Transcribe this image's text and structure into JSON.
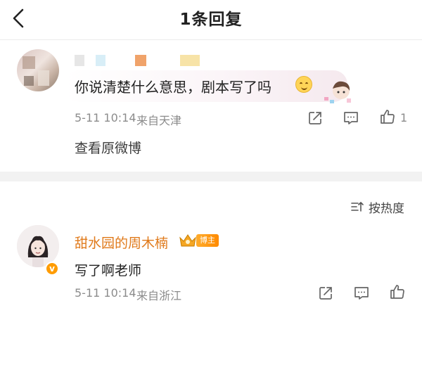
{
  "header": {
    "title": "1条回复"
  },
  "original": {
    "text": "你说清楚什么意思，剧本写了吗",
    "time": "5-11 10:14",
    "source": "来自天津",
    "like_count": "1",
    "view_original_label": "查看原微博"
  },
  "sort": {
    "label": "按热度"
  },
  "reply": {
    "username": "甜水园的周木楠",
    "badge": "博主",
    "text": "写了啊老师",
    "time": "5-11 10:14",
    "source": "来自浙江"
  },
  "colors": {
    "username": "#e07a1b",
    "badge": "#ff8a00",
    "separator": "#f2f2f2"
  },
  "icons": [
    "back-icon",
    "smiley-emoji-icon",
    "share-icon",
    "comment-icon",
    "like-icon",
    "sort-icon",
    "crown-icon",
    "verified-icon"
  ]
}
